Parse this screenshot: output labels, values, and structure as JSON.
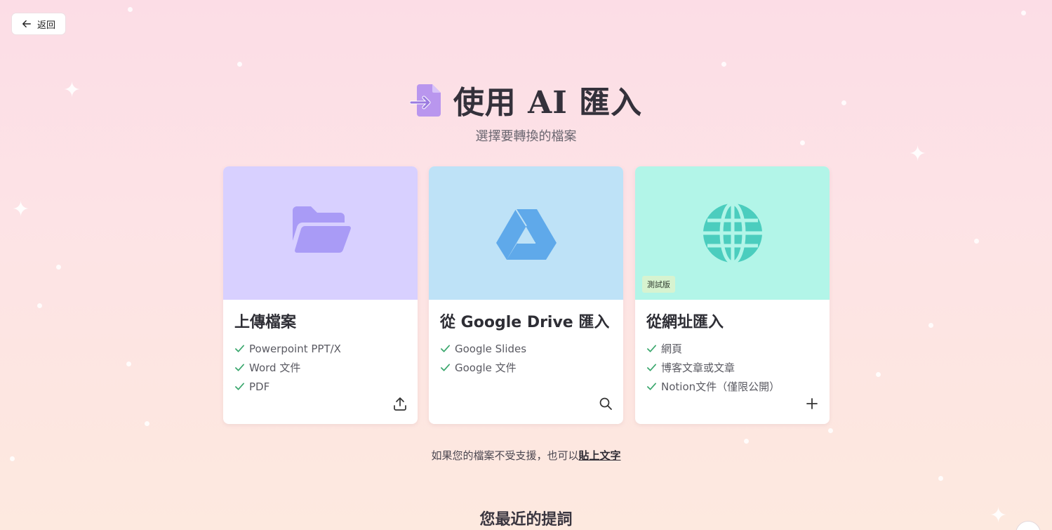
{
  "back": {
    "label": "返回"
  },
  "header": {
    "title": "使用 AI 匯入",
    "subtitle": "選擇要轉換的檔案"
  },
  "cards": [
    {
      "title": "上傳檔案",
      "items": [
        "Powerpoint PPT/X",
        "Word 文件",
        "PDF"
      ],
      "art_color": "#d8d0ff",
      "icon": "folder-icon",
      "action_icon": "upload-icon"
    },
    {
      "title": "從 Google Drive 匯入",
      "items": [
        "Google Slides",
        "Google 文件"
      ],
      "art_color": "#bee2f7",
      "icon": "google-drive-icon",
      "action_icon": "search-icon"
    },
    {
      "title": "從網址匯入",
      "items": [
        "網頁",
        "博客文章或文章",
        "Notion文件（僅限公開）"
      ],
      "art_color": "#b2f5e8",
      "icon": "globe-icon",
      "action_icon": "plus-icon",
      "badge": "測試版"
    }
  ],
  "note": {
    "text": "如果您的檔案不受支援，也可以",
    "link": "貼上文字"
  },
  "recent": {
    "title": "您最近的提詞"
  },
  "colors": {
    "accent_purple": "#a99bf6",
    "drive_blue": "#5fa9ea",
    "globe_teal": "#4bcdbe",
    "check_green": "#3aa76d"
  }
}
